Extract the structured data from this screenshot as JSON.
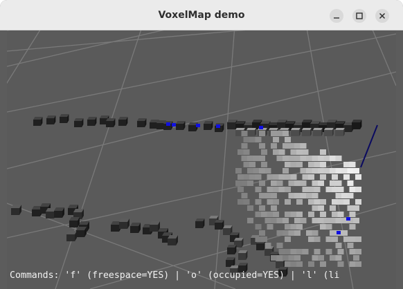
{
  "window": {
    "title": "VoxelMap demo",
    "controls": {
      "minimize": "minimize-icon",
      "maximize": "maximize-icon",
      "close": "close-icon"
    }
  },
  "viewport": {
    "background_color": "#5a5a5a",
    "grid_color": "#7a7a7a",
    "occupied_voxel_color": "#3a3a3a",
    "highlight_voxel_color": "#1010e0",
    "ray_color": "#0a0a60",
    "free_space_gradient": [
      "#777777",
      "#ffffff"
    ],
    "command_text": "Commands: 'f' (freespace=YES) | 'o' (occupied=YES) | 'l' (li"
  }
}
